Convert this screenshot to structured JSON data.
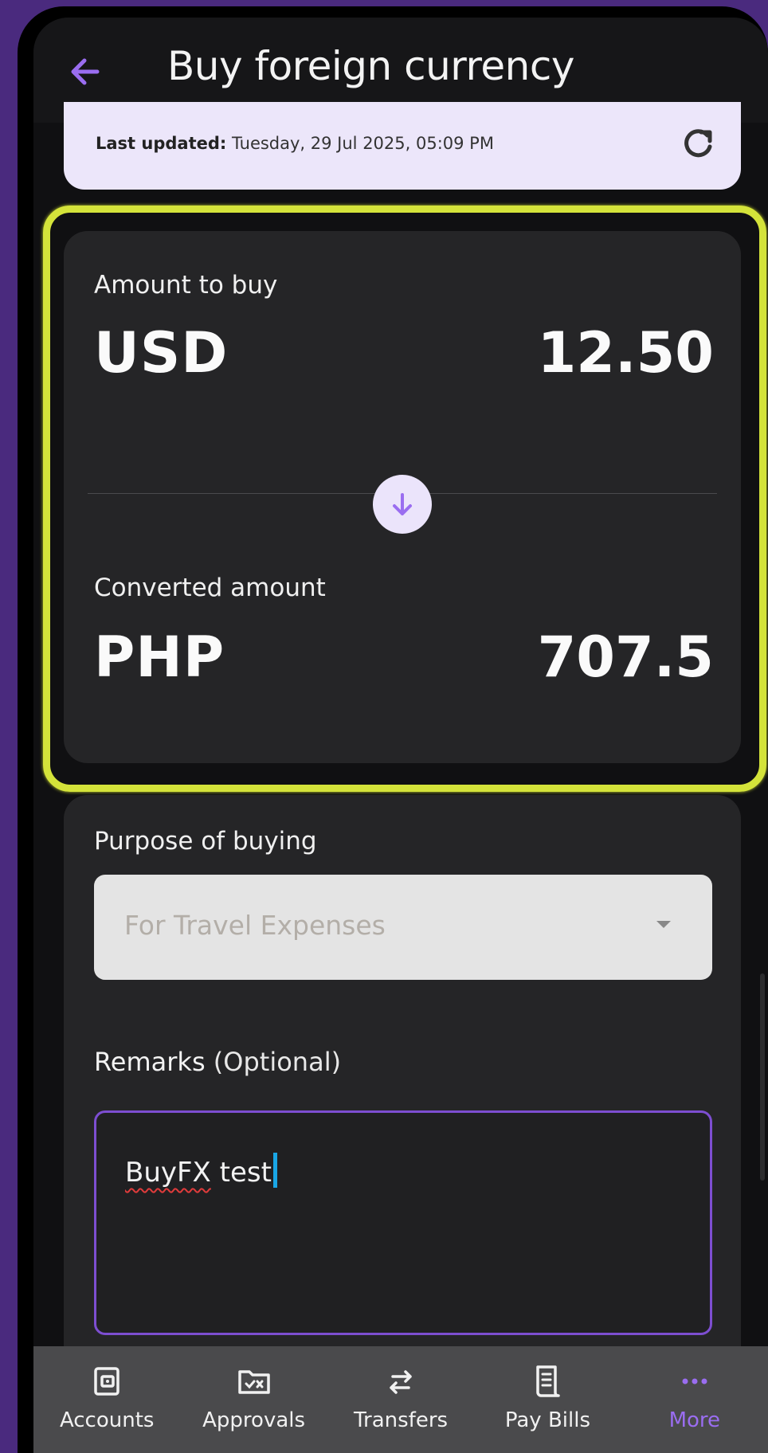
{
  "header": {
    "title": "Buy foreign currency"
  },
  "rate": {
    "last_updated_label": "Last updated:",
    "last_updated_value": "Tuesday, 29 Jul 2025, 05:09 PM"
  },
  "amount": {
    "buy_label": "Amount to buy",
    "buy_currency": "USD",
    "buy_value": "12.50",
    "converted_label": "Converted amount",
    "converted_currency": "PHP",
    "converted_value": "707.5"
  },
  "form": {
    "purpose_label": "Purpose of buying",
    "purpose_value": "For Travel Expenses",
    "remarks_label": "Remarks",
    "remarks_optional": "(Optional)",
    "remarks_word1": "BuyFX",
    "remarks_word2": " test"
  },
  "nav": {
    "items": [
      {
        "label": "Accounts",
        "icon": "wallet-icon"
      },
      {
        "label": "Approvals",
        "icon": "approvals-folder-icon"
      },
      {
        "label": "Transfers",
        "icon": "transfer-arrows-icon"
      },
      {
        "label": "Pay Bills",
        "icon": "receipt-icon"
      },
      {
        "label": "More",
        "icon": "more-dots-icon"
      }
    ],
    "active": "More"
  },
  "colors": {
    "accent": "#9a6df0",
    "highlight": "#d4e33a",
    "background": "#4a2a7e"
  }
}
